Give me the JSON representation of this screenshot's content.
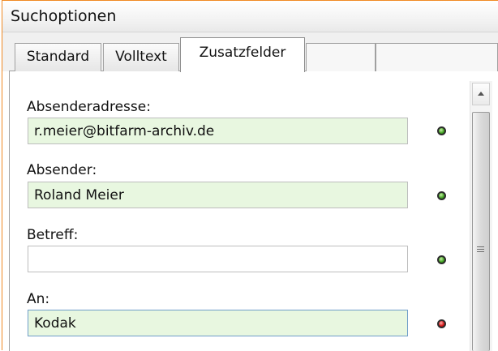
{
  "panel": {
    "title": "Suchoptionen"
  },
  "tabs": [
    {
      "label": "Standard",
      "active": false
    },
    {
      "label": "Volltext",
      "active": false
    },
    {
      "label": "Zusatzfelder",
      "active": true
    }
  ],
  "fields": [
    {
      "label": "Absenderadresse:",
      "value": "r.meier@bitfarm-archiv.de",
      "status": "green"
    },
    {
      "label": "Absender:",
      "value": "Roland Meier",
      "status": "green"
    },
    {
      "label": "Betreff:",
      "value": "",
      "status": "green"
    },
    {
      "label": "An:",
      "value": "Kodak",
      "status": "red"
    }
  ],
  "colors": {
    "accent_border": "#f08a24",
    "filled_field_bg": "#e8f7e0",
    "status_green": "#3fa21f",
    "status_red": "#d41414"
  },
  "icons": {
    "status": "status-led-icon",
    "scroll_up": "scroll-up-arrow-icon",
    "scroll_grip": "scroll-grip-icon"
  }
}
